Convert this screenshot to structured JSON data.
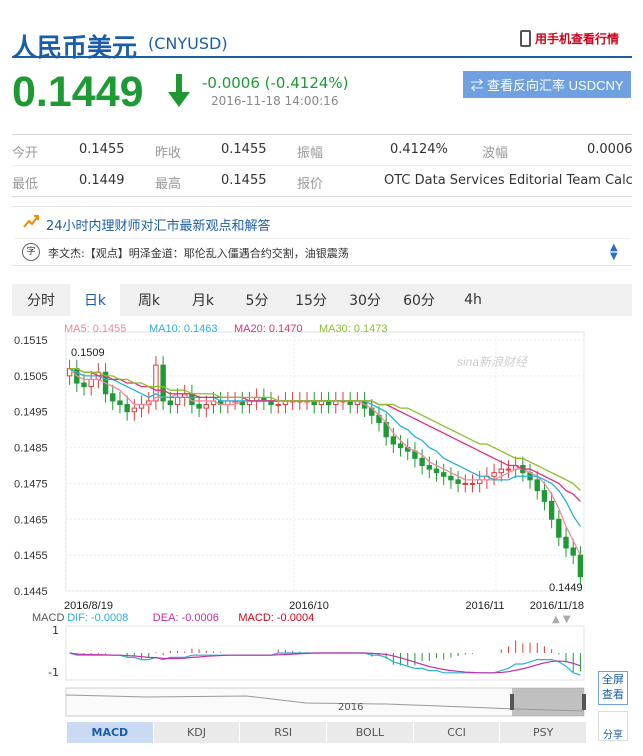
{
  "header": {
    "title": "人民币美元",
    "code": "(CNYUSD)",
    "mobile_label": "用手机查看行情"
  },
  "quote": {
    "price": "0.1449",
    "change": "-0.0006 (-0.4124%)",
    "time": "2016-11-18 14:00:16",
    "reverse_label": "⇄ 查看反向汇率 USDCNY",
    "color_down": "#1e9a34"
  },
  "stats": {
    "row1": [
      {
        "label": "今开",
        "value": "0.1455"
      },
      {
        "label": "昨收",
        "value": "0.1455"
      },
      {
        "label": "振幅",
        "value": "0.4124%"
      },
      {
        "label": "波幅",
        "value": "0.0006"
      }
    ],
    "row2": [
      {
        "label": "最低",
        "value": "0.1449"
      },
      {
        "label": "最高",
        "value": "0.1455"
      },
      {
        "label": "报价",
        "value": "OTC Data Services Editorial Team Calc..."
      }
    ]
  },
  "bulletin": {
    "title": "24小时内理财师对汇市最新观点和解答",
    "news": "李文杰:【观点】明泽金道：耶伦乱入僵遇合约交割，油银震荡",
    "icon_label": "字"
  },
  "tabs": [
    {
      "label": "分时",
      "active": false
    },
    {
      "label": "日k",
      "active": true
    },
    {
      "label": "周k",
      "active": false
    },
    {
      "label": "月k",
      "active": false
    },
    {
      "label": "5分",
      "active": false
    },
    {
      "label": "15分",
      "active": false
    },
    {
      "label": "30分",
      "active": false
    },
    {
      "label": "60分",
      "active": false
    },
    {
      "label": "4h",
      "active": false
    }
  ],
  "chart_data": {
    "type": "candlestick",
    "ma_labels": [
      {
        "text": "MA5: 0.1455",
        "color": "#f08aa0"
      },
      {
        "text": "MA10: 0.1463",
        "color": "#2ab0d8"
      },
      {
        "text": "MA20: 0.1470",
        "color": "#e0307a"
      },
      {
        "text": "MA30: 0.1473",
        "color": "#8cbf2a"
      }
    ],
    "y_ticks": [
      "0.1515",
      "0.1505",
      "0.1495",
      "0.1485",
      "0.1475",
      "0.1465",
      "0.1455",
      "0.1445"
    ],
    "ylim": [
      0.1445,
      0.1515
    ],
    "x_labels": [
      "2016/8/19",
      "2016/10",
      "2016/11",
      "2016/11/18"
    ],
    "high_annotation": "0.1509",
    "low_annotation": "0.1449",
    "watermark": "sina新浪财经",
    "closes": [
      0.1507,
      0.1503,
      0.1502,
      0.1504,
      0.1506,
      0.15,
      0.1498,
      0.1497,
      0.1495,
      0.1496,
      0.1497,
      0.1498,
      0.1508,
      0.1498,
      0.1497,
      0.1499,
      0.15,
      0.1497,
      0.1496,
      0.1497,
      0.1498,
      0.1497,
      0.1498,
      0.1498,
      0.1497,
      0.1498,
      0.1499,
      0.1498,
      0.1497,
      0.1497,
      0.1498,
      0.1498,
      0.1498,
      0.1498,
      0.1497,
      0.1498,
      0.1497,
      0.1498,
      0.1498,
      0.1497,
      0.1498,
      0.1496,
      0.1494,
      0.1492,
      0.1488,
      0.1486,
      0.1485,
      0.1484,
      0.1482,
      0.148,
      0.1479,
      0.1478,
      0.1477,
      0.1476,
      0.1475,
      0.1475,
      0.1475,
      0.1476,
      0.1477,
      0.1478,
      0.1479,
      0.1479,
      0.148,
      0.1478,
      0.1476,
      0.1473,
      0.147,
      0.1465,
      0.146,
      0.1457,
      0.1455,
      0.1449
    ],
    "ma5": [
      0.1507,
      0.1505,
      0.1504,
      0.1504,
      0.1504,
      0.1503,
      0.1502,
      0.1501,
      0.1499,
      0.1497,
      0.1497,
      0.1497,
      0.1499,
      0.1499,
      0.1499,
      0.15,
      0.15,
      0.1498,
      0.1498,
      0.1498,
      0.1498,
      0.1497,
      0.1497,
      0.1497,
      0.1498,
      0.1498,
      0.1498,
      0.1498,
      0.1498,
      0.1498,
      0.1498,
      0.1498,
      0.1498,
      0.1498,
      0.1498,
      0.1498,
      0.1498,
      0.1498,
      0.1498,
      0.1498,
      0.1498,
      0.1497,
      0.1496,
      0.1494,
      0.1492,
      0.1489,
      0.1487,
      0.1485,
      0.1484,
      0.1483,
      0.1481,
      0.148,
      0.1479,
      0.1478,
      0.1477,
      0.1476,
      0.1476,
      0.1476,
      0.1476,
      0.1476,
      0.1477,
      0.1478,
      0.1479,
      0.1479,
      0.1478,
      0.1477,
      0.1475,
      0.1472,
      0.1468,
      0.1463,
      0.1459,
      0.1455
    ],
    "ma10": [
      0.1507,
      0.1506,
      0.1505,
      0.1505,
      0.1505,
      0.1504,
      0.1504,
      0.1503,
      0.1502,
      0.1501,
      0.15,
      0.1499,
      0.15,
      0.1499,
      0.1499,
      0.1499,
      0.1499,
      0.1499,
      0.1499,
      0.1499,
      0.1499,
      0.1498,
      0.1498,
      0.1498,
      0.1498,
      0.1498,
      0.1498,
      0.1498,
      0.1498,
      0.1498,
      0.1498,
      0.1498,
      0.1498,
      0.1498,
      0.1498,
      0.1498,
      0.1498,
      0.1498,
      0.1498,
      0.1498,
      0.1498,
      0.1498,
      0.1497,
      0.1496,
      0.1495,
      0.1493,
      0.1491,
      0.149,
      0.1488,
      0.1487,
      0.1485,
      0.1484,
      0.1482,
      0.1481,
      0.148,
      0.1479,
      0.1478,
      0.1477,
      0.1477,
      0.1476,
      0.1476,
      0.1476,
      0.1477,
      0.1477,
      0.1477,
      0.1477,
      0.1476,
      0.1475,
      0.1473,
      0.147,
      0.1466,
      0.1463
    ],
    "ma20": [
      0.1507,
      0.1507,
      0.1506,
      0.1506,
      0.1505,
      0.1505,
      0.1504,
      0.1504,
      0.1503,
      0.1503,
      0.1502,
      0.1502,
      0.1501,
      0.1501,
      0.15,
      0.15,
      0.15,
      0.15,
      0.1499,
      0.1499,
      0.1499,
      0.1499,
      0.1499,
      0.1499,
      0.1499,
      0.1498,
      0.1498,
      0.1498,
      0.1498,
      0.1498,
      0.1498,
      0.1498,
      0.1498,
      0.1498,
      0.1498,
      0.1498,
      0.1498,
      0.1498,
      0.1498,
      0.1498,
      0.1498,
      0.1498,
      0.1498,
      0.1497,
      0.1497,
      0.1496,
      0.1495,
      0.1494,
      0.1493,
      0.1492,
      0.1491,
      0.149,
      0.1489,
      0.1488,
      0.1487,
      0.1486,
      0.1485,
      0.1484,
      0.1483,
      0.1482,
      0.1481,
      0.148,
      0.148,
      0.1479,
      0.1479,
      0.1478,
      0.1477,
      0.1476,
      0.1475,
      0.1473,
      0.1472,
      0.147
    ],
    "ma30": [
      0.1507,
      0.1507,
      0.1506,
      0.1506,
      0.1506,
      0.1505,
      0.1505,
      0.1504,
      0.1504,
      0.1503,
      0.1503,
      0.1502,
      0.1502,
      0.1502,
      0.1501,
      0.1501,
      0.1501,
      0.15,
      0.15,
      0.15,
      0.15,
      0.1499,
      0.1499,
      0.1499,
      0.1499,
      0.1499,
      0.1499,
      0.1499,
      0.1499,
      0.1498,
      0.1498,
      0.1498,
      0.1498,
      0.1498,
      0.1498,
      0.1498,
      0.1498,
      0.1498,
      0.1498,
      0.1498,
      0.1498,
      0.1498,
      0.1498,
      0.1497,
      0.1497,
      0.1497,
      0.1496,
      0.1496,
      0.1495,
      0.1494,
      0.1493,
      0.1492,
      0.1491,
      0.149,
      0.1489,
      0.1488,
      0.1487,
      0.1486,
      0.1486,
      0.1485,
      0.1484,
      0.1483,
      0.1482,
      0.1482,
      0.1481,
      0.148,
      0.1479,
      0.1478,
      0.1477,
      0.1476,
      0.1475,
      0.1473
    ],
    "macd_labels": [
      {
        "text": "MACD",
        "color": "#555"
      },
      {
        "text": "DIF: -0.0008",
        "color": "#2ab0d8"
      },
      {
        "text": "DEA: -0.0006",
        "color": "#c030a8"
      },
      {
        "text": "MACD: -0.0004",
        "color": "#d0021b"
      }
    ],
    "macd_ticks": [
      "1",
      "-1"
    ],
    "navigator_label": "2016"
  },
  "indicators": [
    {
      "label": "MACD",
      "active": true
    },
    {
      "label": "KDJ",
      "active": false
    },
    {
      "label": "RSI",
      "active": false
    },
    {
      "label": "BOLL",
      "active": false
    },
    {
      "label": "CCI",
      "active": false
    },
    {
      "label": "PSY",
      "active": false
    }
  ],
  "side": {
    "fullscreen": "全屏查看",
    "share": "分享"
  }
}
